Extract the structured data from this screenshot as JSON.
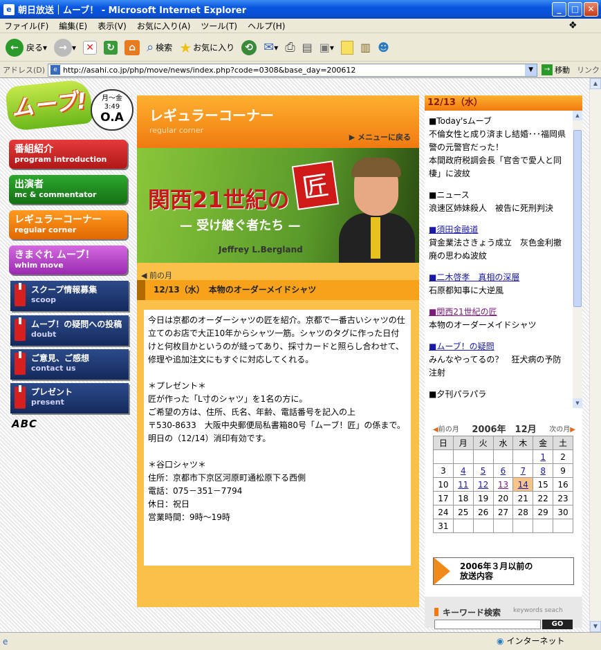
{
  "window": {
    "title": "朝日放送｜ムーブ！ - Microsoft Internet Explorer"
  },
  "menu": [
    "ファイル(F)",
    "編集(E)",
    "表示(V)",
    "お気に入り(A)",
    "ツール(T)",
    "ヘルプ(H)"
  ],
  "toolbar": {
    "back": "戻る",
    "search": "検索",
    "favorites": "お気に入り"
  },
  "address": {
    "label": "アドレス(D)",
    "url": "http://asahi.co.jp/php/move/news/index.php?code=0308&base_day=200612",
    "go": "移動",
    "links": "リンク"
  },
  "status": {
    "zone": "インターネット"
  },
  "logo": {
    "text": "ムーブ!"
  },
  "airtime": {
    "days": "月〜金",
    "time": "3:49",
    "oa": "O.A"
  },
  "nav": [
    {
      "ja": "番組紹介",
      "en": "program introduction"
    },
    {
      "ja": "出演者",
      "en": "mc & commentator"
    },
    {
      "ja": "レギュラーコーナー",
      "en": "regular corner"
    },
    {
      "ja": "きまぐれ ムーブ！",
      "en": "whim move"
    }
  ],
  "subnav": [
    {
      "ja": "スクープ情報募集",
      "en": "scoop"
    },
    {
      "ja": "ムーブ！の疑問への投稿",
      "en": "doubt"
    },
    {
      "ja": "ご意見、ご感想",
      "en": "contact us"
    },
    {
      "ja": "プレゼント",
      "en": "present"
    }
  ],
  "abc": "ABC",
  "corner": {
    "title": "レギュラーコーナー",
    "subtitle": "regular corner",
    "back": "▶ メニューに戻る"
  },
  "banner": {
    "title": "関西21世紀の",
    "takumi": "匠",
    "sub": "— 受け継ぐ者たち —",
    "name": "Jeffrey L.Bergland"
  },
  "prev_month": "◀ 前の月",
  "date_title": "12/13（水）　本物のオーダーメイドシャツ",
  "article": "今日は京都のオーダーシャツの匠を紹介。京都で一番古いシャツの仕立てのお店で大正10年からシャツ一筋。シャツのタグに作った日付けと何枚目かというのが縫ってあり、採寸カードと照らし合わせて、修理や追加注文にもすぐに対応してくれる。\n\n＊プレゼント＊\n匠が作った「L寸のシャツ」を1名の方に。\nご希望の方は、住所、氏名、年齢、電話番号を記入の上\n〒530-8633　大阪中央郵便局私書箱80号「ムーブ！匠」の係まで。\n明日の（12/14）消印有効です。\n\n＊谷口シャツ＊\n住所：京都市下京区河原町通松原下る西側\n電話：075－351－7794\n休日：祝日\n営業時間：9時〜19時",
  "right": {
    "head": "12/13（水）",
    "news": [
      {
        "head": "■Today'sムーブ",
        "body": "不倫女性と成り済まし結婚･･･福岡県警の元警官だった！\n本間政府税調会長「官舎で愛人と同棲」に波紋",
        "link": false
      },
      {
        "head": "■ニュース",
        "body": "浪速区姉妹殺人　被告に死刑判決",
        "link": false
      },
      {
        "head": "■須田金融道",
        "body": "貸金業法さきょう成立　灰色金利撤廃の思わぬ波紋",
        "link": true
      },
      {
        "head": "■二木啓孝　真相の深層",
        "body": "石原都知事に大逆風",
        "link": true
      },
      {
        "head": "■関西21世紀の匠",
        "body": "本物のオーダーメイドシャツ",
        "link": true,
        "visited": true
      },
      {
        "head": "■ムーブ！の疑問",
        "body": "みんなやってるの？　狂犬病の予防注射",
        "link": true
      },
      {
        "head": "■夕刊パラパラ",
        "body": "",
        "link": false
      }
    ]
  },
  "calendar": {
    "prev": "前の月",
    "next": "次の月",
    "title": "2006年　12月",
    "weekdays": [
      "日",
      "月",
      "火",
      "水",
      "木",
      "金",
      "土"
    ],
    "weeks": [
      [
        "",
        "",
        "",
        "",
        "",
        "1",
        "2"
      ],
      [
        "3",
        "4",
        "5",
        "6",
        "7",
        "8",
        "9"
      ],
      [
        "10",
        "11",
        "12",
        "13",
        "14",
        "15",
        "16"
      ],
      [
        "17",
        "18",
        "19",
        "20",
        "21",
        "22",
        "23"
      ],
      [
        "24",
        "25",
        "26",
        "27",
        "28",
        "29",
        "30"
      ],
      [
        "31",
        "",
        "",
        "",
        "",
        "",
        ""
      ]
    ],
    "linked": [
      "1",
      "4",
      "5",
      "6",
      "7",
      "8",
      "11",
      "12",
      "13",
      "14"
    ],
    "visited": [
      "13"
    ],
    "today": "14"
  },
  "archive": "2006年３月以前の\n放送内容",
  "keyword": {
    "label": "キーワード検索",
    "en": "keywords seach",
    "go": "GO"
  }
}
